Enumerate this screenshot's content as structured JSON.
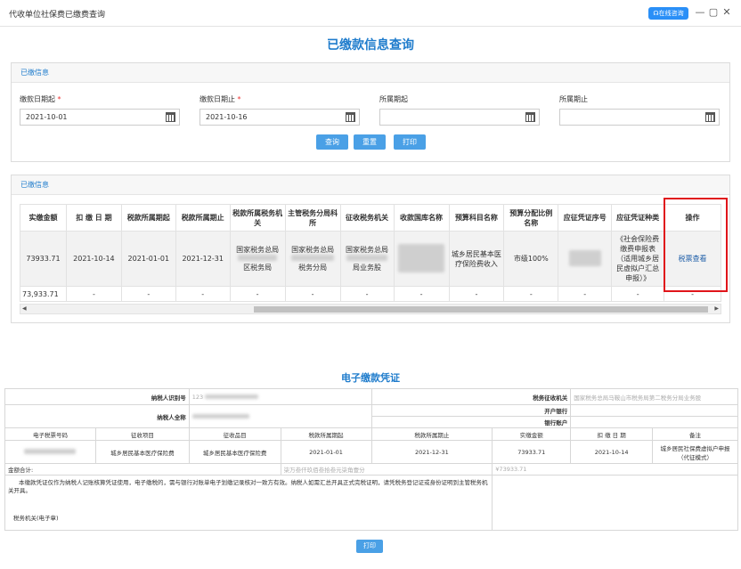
{
  "window": {
    "title": "代收单位社保费已缴费查询",
    "online_label": "在线咨询",
    "minimize": "—",
    "maximize": "▢",
    "close": "✕"
  },
  "page_title": "已缴款信息查询",
  "query_panel": {
    "header": "已缴信息",
    "fields": [
      {
        "label": "缴款日期起",
        "value": "2021-10-01",
        "required": true
      },
      {
        "label": "缴款日期止",
        "value": "2021-10-16",
        "required": true
      },
      {
        "label": "所属期起",
        "value": "",
        "required": false
      },
      {
        "label": "所属期止",
        "value": "",
        "required": false
      }
    ],
    "required_mark": "*",
    "buttons": {
      "query": "查询",
      "reset": "重置",
      "print": "打印"
    }
  },
  "result_panel": {
    "header": "已缴信息",
    "columns": [
      "实缴金额",
      "扣 缴 日 期",
      "税款所属期起",
      "税款所属期止",
      "税款所属税务机关",
      "主管税务分局科所",
      "征收税务机关",
      "收款国库名称",
      "预算科目名称",
      "预算分配比例名称",
      "应征凭证序号",
      "应征凭证种类",
      "操作"
    ],
    "row": {
      "amount": "73933.71",
      "deduct_date": "2021-10-14",
      "period_start": "2021-01-01",
      "period_end": "2021-12-31",
      "tax_office_l1": "国家税务总局",
      "tax_office_l2": "区税务局",
      "branch_l1": "国家税务总局",
      "branch_l2": "税务分局",
      "collect_l1": "国家税务总局",
      "collect_l2": "局业务股",
      "budget_subject": "城乡居民基本医疗保险费收入",
      "ratio": "市级100%",
      "voucher_type": "《社会保险费缴费申报表（适用城乡居民虚拟户汇总申报）》",
      "action": "税票查看"
    },
    "total_row": {
      "amount": "73,933.71",
      "dash": "-"
    }
  },
  "certificate": {
    "title": "电子缴款凭证",
    "taxpayer_id_label": "纳税人识别号",
    "taxpayer_id_value": "123",
    "taxpayer_name_label": "纳税人全称",
    "tax_authority_label": "税务征收机关",
    "tax_authority_value": "国家税务总局马鞍山市税务局第二税务分局业务股",
    "bank_label": "开户银行",
    "account_label": "银行账户",
    "columns": [
      "电子税票号码",
      "征收项目",
      "征收品目",
      "税款所属期起",
      "税款所属期止",
      "实缴金额",
      "扣 缴 日 期",
      "备注"
    ],
    "row": {
      "project": "城乡居民基本医疗保险费",
      "item": "城乡居民基本医疗保险费",
      "period_start": "2021-01-01",
      "period_end": "2021-12-31",
      "amount": "73933.71",
      "date": "2021-10-14",
      "remark": "城乡居民社保费虚拟户申报（代征模式）"
    },
    "total_label": "金额合计:",
    "total_upper": "柒万叁仟玖佰叁拾叁元柒角壹分",
    "total_lower": "¥73933.71",
    "note": "本缴款凭证仅作为纳税人记账核算凭证使用，电子缴税的，需与银行对账单电子划缴记录核对一致方有效。纳税人如需汇总开具正式完税证明，请凭税务登记证或身份证明到主管税务机关开具。",
    "authority_note": "税务机关(电子章)",
    "print_button": "打印"
  },
  "colors": {
    "accent": "#1f7ccc",
    "button": "#4aa0e6",
    "highlight": "#e0141a"
  }
}
